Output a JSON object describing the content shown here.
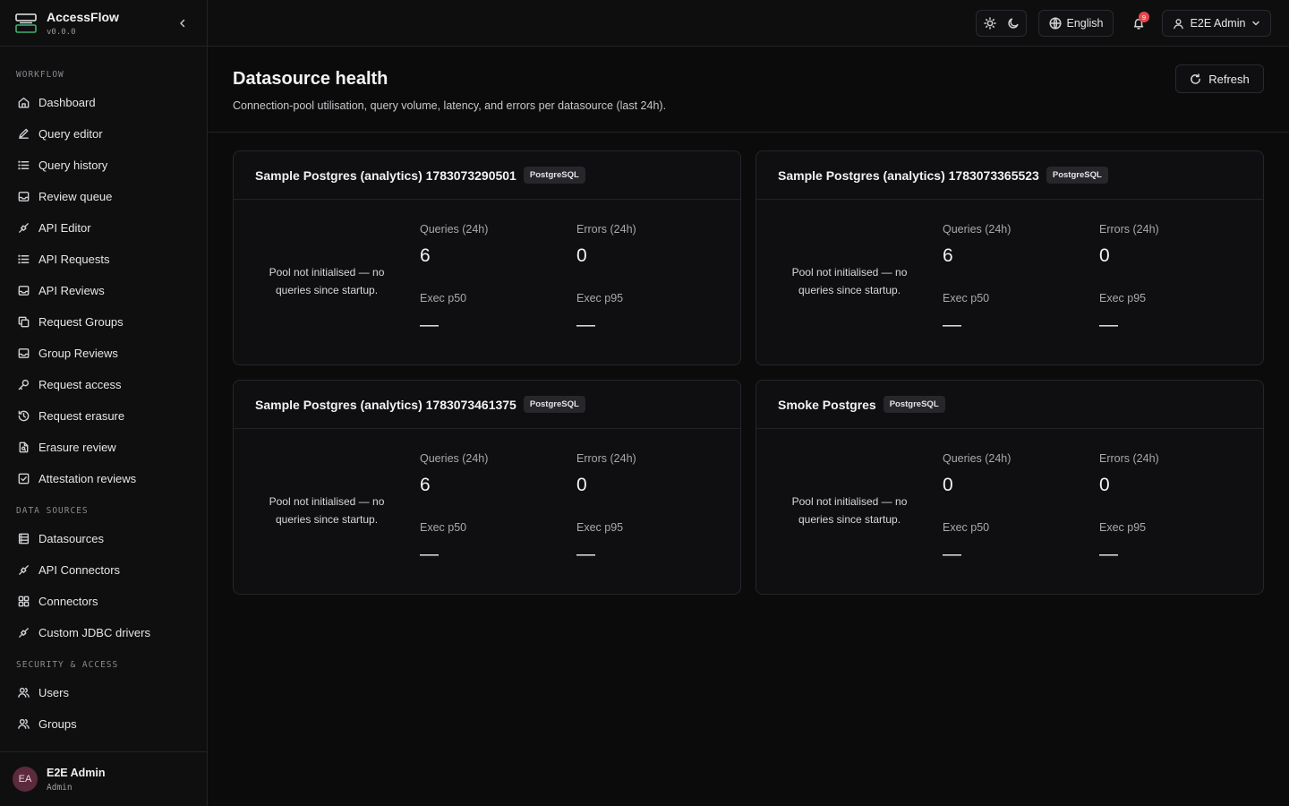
{
  "app": {
    "name": "AccessFlow",
    "version": "v0.0.0"
  },
  "sidebar": {
    "sections": [
      {
        "title": "WORKFLOW",
        "items": [
          {
            "label": "Dashboard",
            "icon": "home-icon"
          },
          {
            "label": "Query editor",
            "icon": "pencil-icon"
          },
          {
            "label": "Query history",
            "icon": "list-icon"
          },
          {
            "label": "Review queue",
            "icon": "inbox-icon"
          },
          {
            "label": "API Editor",
            "icon": "plug-icon"
          },
          {
            "label": "API Requests",
            "icon": "list-icon"
          },
          {
            "label": "API Reviews",
            "icon": "inbox-icon"
          },
          {
            "label": "Request Groups",
            "icon": "copy-icon"
          },
          {
            "label": "Group Reviews",
            "icon": "inbox-icon"
          },
          {
            "label": "Request access",
            "icon": "key-icon"
          },
          {
            "label": "Request erasure",
            "icon": "history-icon"
          },
          {
            "label": "Erasure review",
            "icon": "file-search-icon"
          },
          {
            "label": "Attestation reviews",
            "icon": "check-square-icon"
          }
        ]
      },
      {
        "title": "DATA SOURCES",
        "items": [
          {
            "label": "Datasources",
            "icon": "database-icon"
          },
          {
            "label": "API Connectors",
            "icon": "plug-icon"
          },
          {
            "label": "Connectors",
            "icon": "grid-icon"
          },
          {
            "label": "Custom JDBC drivers",
            "icon": "plug-icon"
          }
        ]
      },
      {
        "title": "SECURITY & ACCESS",
        "items": [
          {
            "label": "Users",
            "icon": "users-icon"
          },
          {
            "label": "Groups",
            "icon": "users-icon"
          }
        ]
      }
    ],
    "user": {
      "initials": "EA",
      "name": "E2E Admin",
      "role": "Admin"
    }
  },
  "topbar": {
    "language": "English",
    "notifications_count": "9",
    "user_label": "E2E Admin"
  },
  "page": {
    "title": "Datasource health",
    "subtitle": "Connection-pool utilisation, query volume, latency, and errors per datasource (last 24h).",
    "refresh_label": "Refresh"
  },
  "labels": {
    "queries": "Queries (24h)",
    "errors": "Errors (24h)",
    "p50": "Exec p50",
    "p95": "Exec p95"
  },
  "cards": [
    {
      "name": "Sample Postgres (analytics) 1783073290501",
      "type": "PostgreSQL",
      "note": "Pool not initialised — no queries since startup.",
      "queries": "6",
      "errors": "0",
      "p50": "—",
      "p95": "—"
    },
    {
      "name": "Sample Postgres (analytics) 1783073365523",
      "type": "PostgreSQL",
      "note": "Pool not initialised — no queries since startup.",
      "queries": "6",
      "errors": "0",
      "p50": "—",
      "p95": "—"
    },
    {
      "name": "Sample Postgres (analytics) 1783073461375",
      "type": "PostgreSQL",
      "note": "Pool not initialised — no queries since startup.",
      "queries": "6",
      "errors": "0",
      "p50": "—",
      "p95": "—"
    },
    {
      "name": "Smoke Postgres",
      "type": "PostgreSQL",
      "note": "Pool not initialised — no queries since startup.",
      "queries": "0",
      "errors": "0",
      "p50": "—",
      "p95": "—"
    }
  ]
}
